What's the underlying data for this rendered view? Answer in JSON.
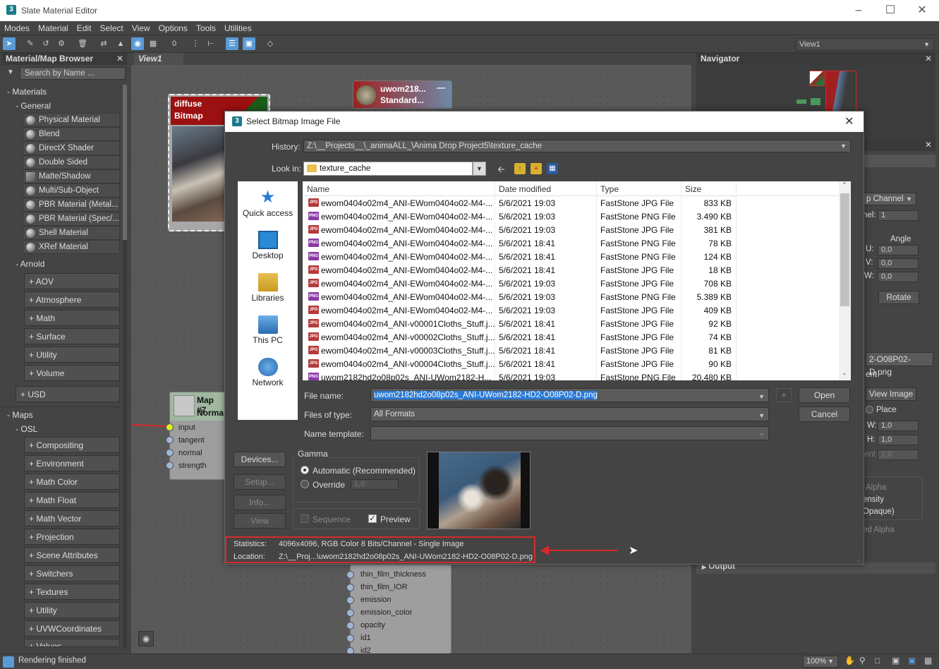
{
  "app": {
    "title": "Slate Material Editor",
    "icon": "3"
  },
  "menu": [
    "Modes",
    "Material",
    "Edit",
    "Select",
    "View",
    "Options",
    "Tools",
    "Utilities"
  ],
  "view_selector": "View1",
  "browser": {
    "title": "Material/Map Browser",
    "search_placeholder": "Search by Name ...",
    "materials_label": "- Materials",
    "general_label": "- General",
    "general_items": [
      "Physical Material",
      "Blend",
      "DirectX Shader",
      "Double Sided",
      "Matte/Shadow",
      "Multi/Sub-Object",
      "PBR Material (Metal...",
      "PBR Material (Spec/...",
      "Shell Material",
      "XRef Material"
    ],
    "arnold_label": "- Arnold",
    "arnold_items": [
      "+ AOV",
      "+ Atmosphere",
      "+ Math",
      "+ Surface",
      "+ Utility",
      "+ Volume"
    ],
    "usd_label": "+ USD",
    "maps_label": "- Maps",
    "osl_label": "- OSL",
    "osl_items": [
      "+ Compositing",
      "+ Environment",
      "+ Math Color",
      "+ Math Float",
      "+ Math Vector",
      "+ Projection",
      "+ Scene Attributes",
      "+ Switchers",
      "+ Textures",
      "+ Utility",
      "+ UVWCoordinates",
      "+ Values"
    ]
  },
  "view": {
    "tab": "View1",
    "node_diffuse": {
      "line1": "diffuse",
      "line2": "Bitmap"
    },
    "node_uwom": {
      "line1": "uwom218...",
      "line2": "Standard..."
    },
    "node_map7": {
      "line1": "Map #7",
      "line2": "Norma",
      "sockets": [
        "input",
        "tangent",
        "normal",
        "strength"
      ]
    },
    "node_bottom_sockets": [
      "thin_film_thickness",
      "thin_film_IOR",
      "emission",
      "emission_color",
      "opacity",
      "id1",
      "id2"
    ]
  },
  "navigator": {
    "title": "Navigator"
  },
  "right_panel": {
    "channel_combo": "p Channel",
    "channel_label": "nel:",
    "channel_value": "1",
    "angle_label": "Angle",
    "u_label": "U:",
    "u_value": "0,0",
    "v_label": "V:",
    "v_value": "0,0",
    "w_label": "W:",
    "w_value": "0,0",
    "rotate_button": "Rotate",
    "filename_field": "2-O08P02-D.png",
    "ent_label": "ent",
    "view_image_button": "View Image",
    "place_label": "Place",
    "w2_label": "W:",
    "w2_value": "1,0",
    "h_label": "H:",
    "h_value": "1,0",
    "j_label": "ent:",
    "j_value": "1,0",
    "alpha_label": "Alpha",
    "ensity_label": "ensity",
    "opaque_label": "Opaque)",
    "ed_alpha_label": "ed Alpha",
    "output_label": "Output"
  },
  "dialog": {
    "title": "Select Bitmap Image File",
    "history_label": "History:",
    "history_value": "Z:\\__Projects__\\_animaALL_\\Anima Drop Project5\\texture_cache",
    "lookin_label": "Look in:",
    "lookin_value": "texture_cache",
    "places": [
      "Quick access",
      "Desktop",
      "Libraries",
      "This PC",
      "Network"
    ],
    "columns": [
      "Name",
      "Date modified",
      "Type",
      "Size"
    ],
    "files": [
      {
        "icon": "JPG",
        "name": "ewom0404o02m4_ANI-EWom0404o02-M4-...",
        "date": "5/6/2021 19:03",
        "type": "FastStone JPG File",
        "size": "833 KB"
      },
      {
        "icon": "PNG",
        "name": "ewom0404o02m4_ANI-EWom0404o02-M4-...",
        "date": "5/6/2021 19:03",
        "type": "FastStone PNG File",
        "size": "3.490 KB"
      },
      {
        "icon": "JPG",
        "name": "ewom0404o02m4_ANI-EWom0404o02-M4-...",
        "date": "5/6/2021 19:03",
        "type": "FastStone JPG File",
        "size": "381 KB"
      },
      {
        "icon": "PNG",
        "name": "ewom0404o02m4_ANI-EWom0404o02-M4-...",
        "date": "5/6/2021 18:41",
        "type": "FastStone PNG File",
        "size": "78 KB"
      },
      {
        "icon": "PNG",
        "name": "ewom0404o02m4_ANI-EWom0404o02-M4-...",
        "date": "5/6/2021 18:41",
        "type": "FastStone PNG File",
        "size": "124 KB"
      },
      {
        "icon": "JPG",
        "name": "ewom0404o02m4_ANI-EWom0404o02-M4-...",
        "date": "5/6/2021 18:41",
        "type": "FastStone JPG File",
        "size": "18 KB"
      },
      {
        "icon": "JPG",
        "name": "ewom0404o02m4_ANI-EWom0404o02-M4-...",
        "date": "5/6/2021 19:03",
        "type": "FastStone JPG File",
        "size": "708 KB"
      },
      {
        "icon": "PNG",
        "name": "ewom0404o02m4_ANI-EWom0404o02-M4-...",
        "date": "5/6/2021 19:03",
        "type": "FastStone PNG File",
        "size": "5.389 KB"
      },
      {
        "icon": "JPG",
        "name": "ewom0404o02m4_ANI-EWom0404o02-M4-...",
        "date": "5/6/2021 19:03",
        "type": "FastStone JPG File",
        "size": "409 KB"
      },
      {
        "icon": "JPG",
        "name": "ewom0404o02m4_ANI-v00001Cloths_Stuff.j...",
        "date": "5/6/2021 18:41",
        "type": "FastStone JPG File",
        "size": "92 KB"
      },
      {
        "icon": "JPG",
        "name": "ewom0404o02m4_ANI-v00002Cloths_Stuff.j...",
        "date": "5/6/2021 18:41",
        "type": "FastStone JPG File",
        "size": "74 KB"
      },
      {
        "icon": "JPG",
        "name": "ewom0404o02m4_ANI-v00003Cloths_Stuff.j...",
        "date": "5/6/2021 18:41",
        "type": "FastStone JPG File",
        "size": "81 KB"
      },
      {
        "icon": "JPG",
        "name": "ewom0404o02m4_ANI-v00004Cloths_Stuff.j...",
        "date": "5/6/2021 18:41",
        "type": "FastStone JPG File",
        "size": "90 KB"
      },
      {
        "icon": "PNG",
        "name": "uwom2182hd2o08p02s_ANI-UWom2182-H...",
        "date": "5/6/2021 19:03",
        "type": "FastStone PNG File",
        "size": "20.480 KB"
      }
    ],
    "filename_label": "File name:",
    "filename_value": "uwom2182hd2o08p02s_ANI-UWom2182-HD2-O08P02-D.png",
    "filetype_label": "Files of type:",
    "filetype_value": "All Formats",
    "template_label": "Name template:",
    "template_value": "",
    "open_button": "Open",
    "cancel_button": "Cancel",
    "plus_button": "+",
    "devices_button": "Devices...",
    "setup_button": "Setup...",
    "info_button": "Info...",
    "view_button": "View",
    "gamma_label": "Gamma",
    "gamma_auto": "Automatic (Recommended)",
    "gamma_override": "Override",
    "gamma_override_value": "1,0",
    "sequence_label": "Sequence",
    "preview_label": "Preview",
    "stats_label": "Statistics:",
    "stats_value": "4096x4096, RGB Color 8 Bits/Channel - Single Image",
    "location_label": "Location:",
    "location_value": "Z:\\__Proj...\\uwom2182hd2o08p02s_ANI-UWom2182-HD2-O08P02-D.png"
  },
  "status": {
    "text": "Rendering finished",
    "zoom": "100%"
  },
  "colors": {
    "accent": "#5a9ad6",
    "annotation_red": "#d42a2a",
    "node_red": "#9b1010"
  }
}
